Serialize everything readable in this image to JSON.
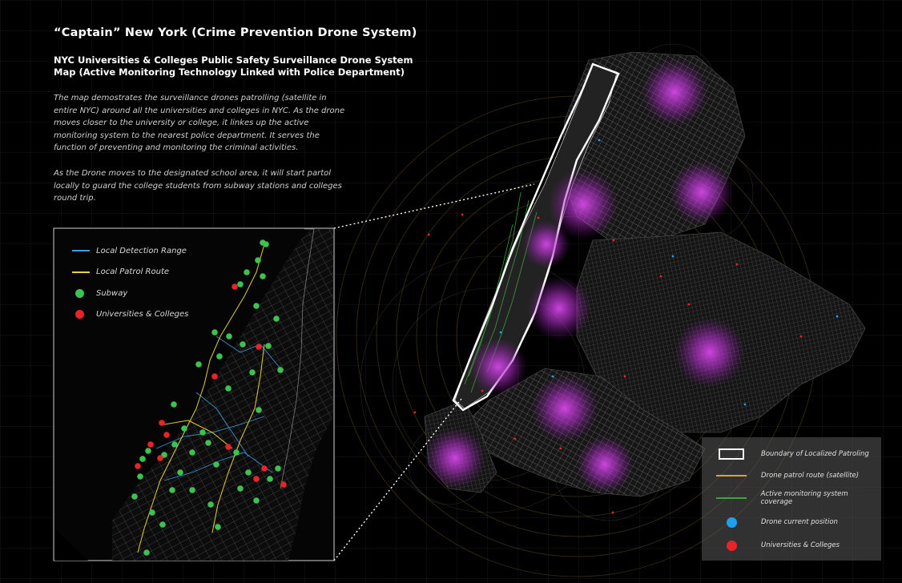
{
  "header": {
    "title": "“Captain” New York (Crime Prevention Drone System)",
    "subtitle": "NYC Universities & Colleges Public Safety Surveillance Drone System Map (Active Monitoring Technology Linked with Police Department)",
    "description_1": "The map demostrates the surveillance drones patrolling (satellite in entire NYC) around all the universities and colleges in NYC. As the drone moves closer to the university or college, it linkes up the active monitoring system to the nearest police department. It serves the function of preventing and monitoring the criminal activities.",
    "description_2": "As the Drone moves to the designated school area, it will start partol locally to guard the college students from subway stations and colleges round trip."
  },
  "inset_legend": [
    {
      "label": "Local Detection Range",
      "type": "line",
      "color": "#3aa0e8"
    },
    {
      "label": "Local Patrol Route",
      "type": "line",
      "color": "#e8d23a"
    },
    {
      "label": "Subway",
      "type": "dot",
      "color": "#3cc24f"
    },
    {
      "label": "Universities & Colleges",
      "type": "dot",
      "color": "#e8232a"
    }
  ],
  "map_legend": [
    {
      "label": "Boundary of Localized Patroling",
      "type": "rect",
      "color": "#ffffff"
    },
    {
      "label": "Drone patrol route (satellite)",
      "type": "line",
      "color": "#d4a53a"
    },
    {
      "label": "Active monitoring system coverage",
      "type": "line",
      "color": "#3fa33f"
    },
    {
      "label": "Drone current position",
      "type": "dot",
      "color": "#1ea0f0"
    },
    {
      "label": "Universities & Colleges",
      "type": "dot",
      "color": "#e8232a"
    }
  ],
  "colors": {
    "background": "#000000",
    "drone_glow": "#c23ad6",
    "subway": "#3cc24f",
    "college": "#e8232a",
    "patrol_route": "#d4a53a"
  }
}
